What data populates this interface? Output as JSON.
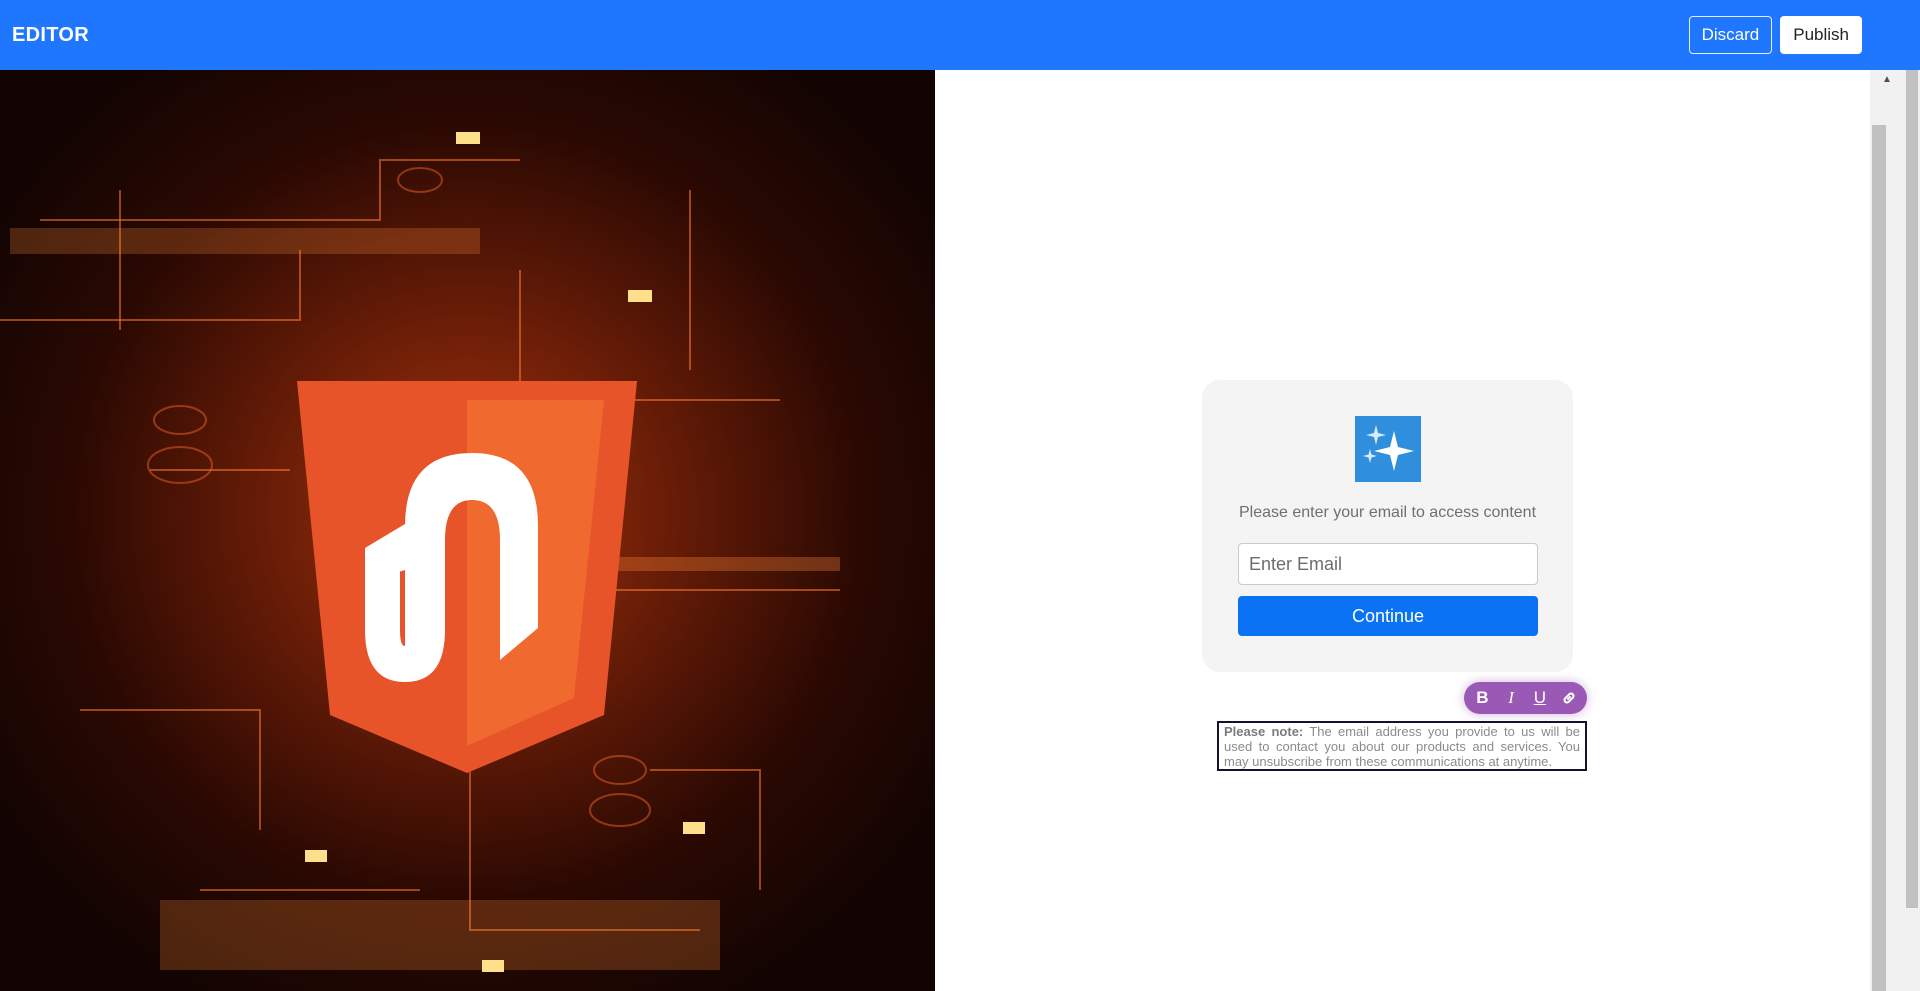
{
  "topbar": {
    "title": "EDITOR",
    "discard_label": "Discard",
    "publish_label": "Publish",
    "background": "#1f76ff"
  },
  "hero_image": {
    "description_icon": "logo-hexagon-shield",
    "accent": "#e8542a"
  },
  "card": {
    "icon": "sparkles-icon",
    "prompt": "Please enter your email to access content",
    "email_placeholder": "Enter Email",
    "email_value": "",
    "continue_label": "Continue",
    "button_color": "#0a73f5"
  },
  "format_toolbar": {
    "bold_label": "B",
    "italic_label": "I",
    "underline_label": "U",
    "link_icon": "link-icon",
    "color": "#9b59b6"
  },
  "note": {
    "strong": "Please note:",
    "text": " The email address you provide to us will be used to contact you about our products and services. You may unsubscribe from these communications at anytime."
  }
}
